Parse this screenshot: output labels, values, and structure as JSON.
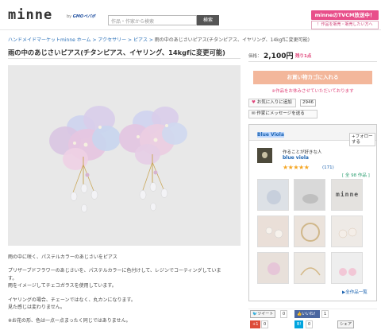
{
  "header": {
    "logo": "minne",
    "by": "by",
    "by_brand": "GMOペパボ",
    "search_placeholder": "作品・作家から検索",
    "search_button": "検索",
    "tvcm": "minneのTVCM放送中！",
    "sell": "！作品を販売・販売したい方へ"
  },
  "breadcrumb": {
    "items": [
      "ハンドメイドマーケットminne ホーム",
      "アクセサリー",
      "ピアス"
    ],
    "current": "雨の中のあじさいピアス(チタンピアス、イヤリング、14kgfに変更可能)",
    "separator": " > "
  },
  "product": {
    "title": "雨の中のあじさいピアス(チタンピアス、イヤリング、14kgfに変更可能)",
    "price_label": "価格：",
    "price": "2,100円",
    "stock": "残り1点",
    "cart_button": "お買い物カゴに入れる",
    "sold_note": "※作品をお休みさせていただいております",
    "fav_button": "お気に入りに追加",
    "fav_count": "2946",
    "message_button": "作家にメッセージを送る",
    "description": [
      "雨の中に咲く、パステルカラーのあじさいをピアス",
      "",
      "プリザーブドフラワーのあじさいを、パステルカラーに色付けして、レジンでコーティングしていま",
      "す。",
      "雨をイメージしてチェコガラスを使用しています。",
      "",
      "イヤリングの場合、チェーンではなく、丸カンになります。",
      "見た感じは変わりません。",
      "",
      "※お花の形、色は一点一点まったく同じではありません。"
    ]
  },
  "shop": {
    "name": "Blue Viola",
    "follow_button": "フォローする",
    "tagline": "作ることが好きな人",
    "user": "blue viola",
    "stars": "★★★★★",
    "rating_count": "(171)",
    "all_items": "[ 全 98 作品 ]",
    "thumb_label": "minne",
    "all_items_link": "▶全作品一覧"
  },
  "social": {
    "tweet": "ツイート",
    "tweet_count": "0",
    "like": "いいね！",
    "like_count": "1",
    "gplus": "+1",
    "gplus_count": "0",
    "hatena": "B!",
    "hatena_count": "0",
    "share": "シェア"
  }
}
